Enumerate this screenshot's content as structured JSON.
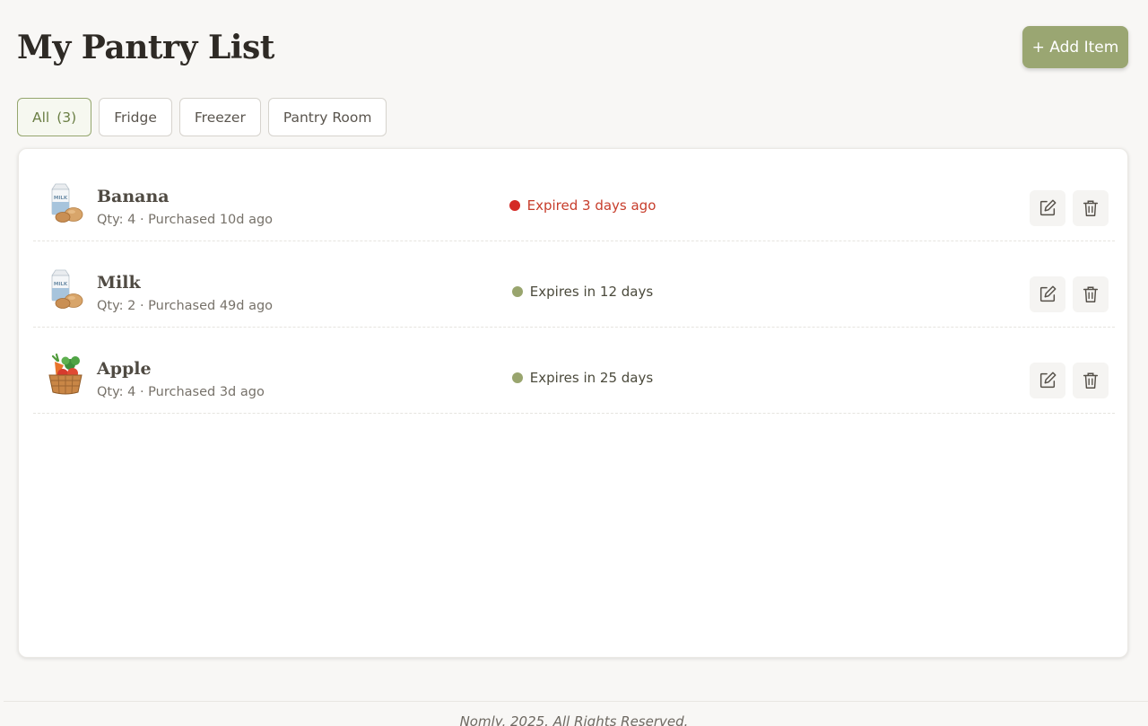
{
  "header": {
    "title": "My Pantry List",
    "add_button_label": "+ Add Item"
  },
  "filters": {
    "tabs": [
      {
        "label": "All",
        "count": "(3)",
        "active": true
      },
      {
        "label": "Fridge"
      },
      {
        "label": "Freezer"
      },
      {
        "label": "Pantry Room"
      }
    ]
  },
  "items": [
    {
      "name": "Banana",
      "meta": "Qty: 4 · Purchased 10d ago",
      "status": "Expired 3 days ago",
      "status_type": "expired",
      "icon": "milk-and-bread-icon"
    },
    {
      "name": "Milk",
      "meta": "Qty: 2 · Purchased 49d ago",
      "status": "Expires in 12 days",
      "status_type": "fresh",
      "icon": "milk-and-bread-icon"
    },
    {
      "name": "Apple",
      "meta": "Qty: 4 · Purchased 3d ago",
      "status": "Expires in 25 days",
      "status_type": "fresh",
      "icon": "produce-basket-icon"
    }
  ],
  "actions": {
    "edit_icon": "edit-icon",
    "delete_icon": "trash-icon"
  },
  "colors": {
    "accent": "#9aa672",
    "expired_dot": "#d42a26",
    "expired_text": "#c73d2b",
    "fresh_dot": "#99a56e",
    "fresh_text": "#4b4a3c"
  },
  "footer": {
    "text": "Nomly, 2025. All Rights Reserved."
  }
}
